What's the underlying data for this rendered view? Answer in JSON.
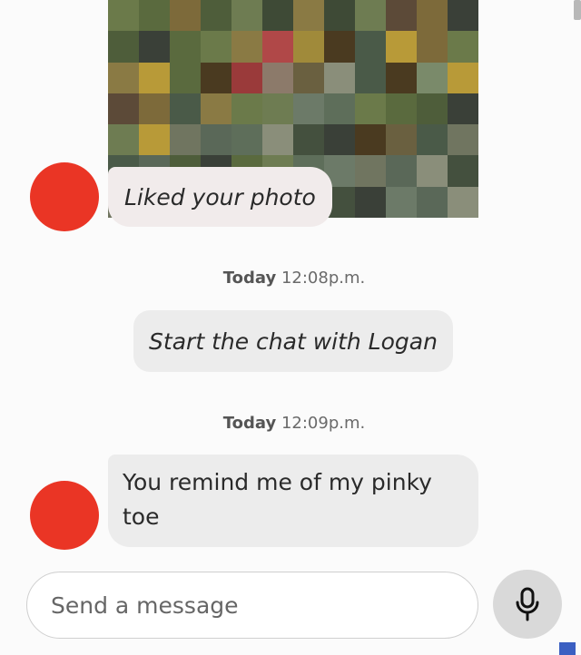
{
  "liked_message": {
    "text": "Liked your photo",
    "photo_icon": "pixelated-photo-thumbnail"
  },
  "timestamps": [
    {
      "day": "Today",
      "time": "12:08p.m."
    },
    {
      "day": "Today",
      "time": "12:09p.m."
    }
  ],
  "system_message": {
    "text": "Start the chat with Logan"
  },
  "chat_message": {
    "line1": "You remind me of my pinky",
    "line2": "toe"
  },
  "composer": {
    "placeholder": "Send a message",
    "mic_icon": "microphone-icon"
  },
  "colors": {
    "avatar": "#ea3525",
    "bubble_liked": "#f1ebeb",
    "bubble": "#ececec",
    "mic_button": "#d9d9d9"
  }
}
